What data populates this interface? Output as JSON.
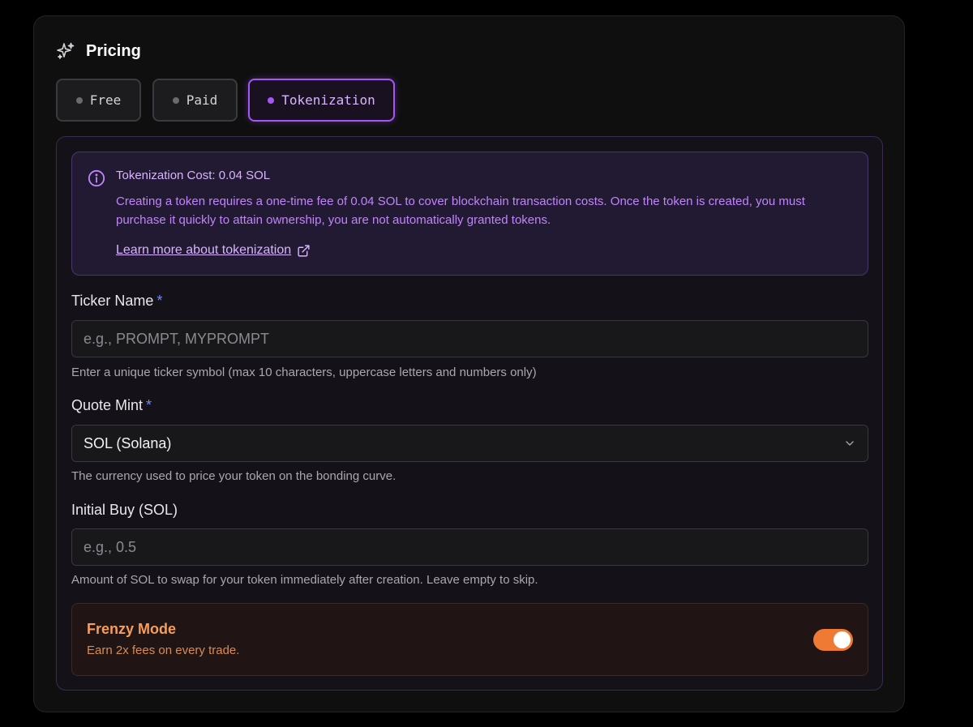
{
  "pricing": {
    "title": "Pricing",
    "icon": "sparkles-icon",
    "tabs": [
      {
        "label": "Free",
        "state": "inactive"
      },
      {
        "label": "Paid",
        "state": "inactive"
      },
      {
        "label": "Tokenization",
        "state": "active"
      }
    ]
  },
  "info": {
    "title": "Tokenization Cost: 0.04 SOL",
    "body": "Creating a token requires a one-time fee of 0.04 SOL to cover blockchain transaction costs. Once the token is created, you must purchase it quickly to attain ownership, you are not automatically granted tokens.",
    "link": "Learn more about tokenization"
  },
  "form": {
    "ticker": {
      "label": "Ticker Name",
      "required": "*",
      "placeholder": "e.g., PROMPT, MYPROMPT",
      "help": "Enter a unique ticker symbol (max 10 characters, uppercase letters and numbers only)"
    },
    "quote_mint": {
      "label": "Quote Mint",
      "required": "*",
      "value": "SOL (Solana)",
      "help": "The currency used to price your token on the bonding curve."
    },
    "initial_buy": {
      "label": "Initial Buy (SOL)",
      "placeholder": "e.g., 0.5",
      "help": "Amount of SOL to swap for your token immediately after creation. Leave empty to skip."
    }
  },
  "frenzy": {
    "title": "Frenzy Mode",
    "description": "Earn 2x fees on every trade.",
    "enabled": true
  },
  "colors": {
    "accent_purple": "#a855f7",
    "accent_orange": "#ee7a34",
    "required_star": "#6b8cff"
  }
}
